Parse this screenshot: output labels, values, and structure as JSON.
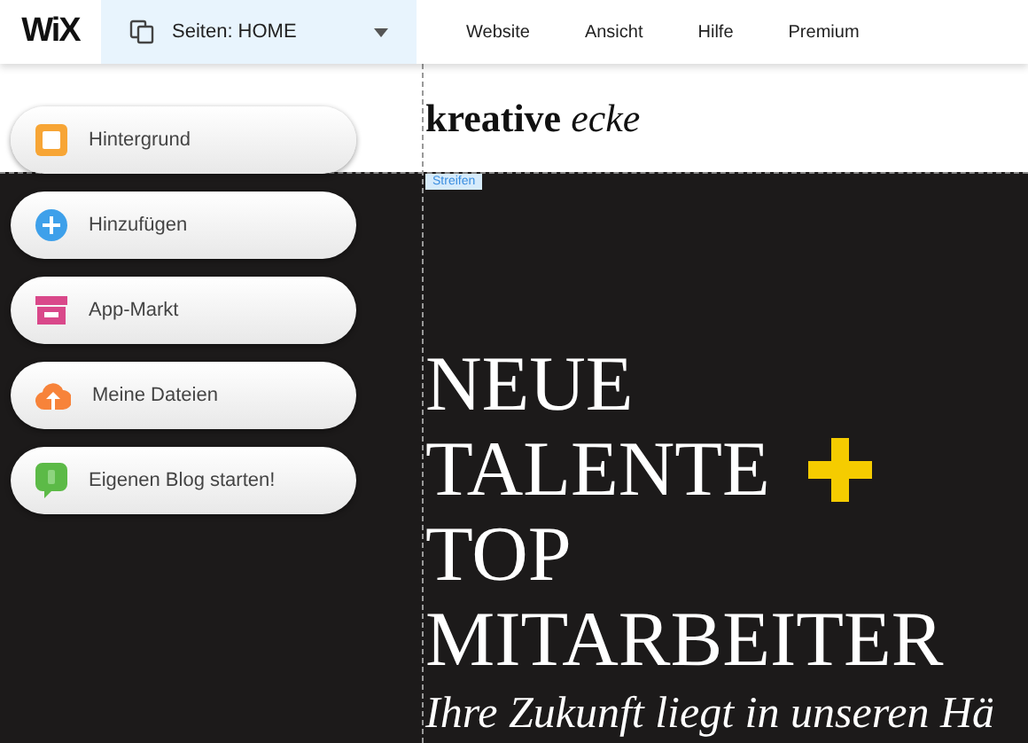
{
  "top_bar": {
    "logo": "WiX",
    "pages_menu": {
      "label": "Seiten: HOME"
    },
    "menu": [
      "Website",
      "Ansicht",
      "Hilfe",
      "Premium"
    ]
  },
  "site": {
    "title": "**kreative** *ecke*",
    "section_label": "Streifen",
    "headline": [
      {
        "text": "NEUE",
        "plus": false
      },
      {
        "text": "TALENTE",
        "plus": true
      },
      {
        "text": "TOP",
        "plus": false
      },
      {
        "text": "MITARBEITER",
        "plus": false
      }
    ],
    "subtitle": "Ihre Zukunft liegt in unseren Hä"
  },
  "sidebar": {
    "items": [
      {
        "kind": "background",
        "label": "Hintergrund"
      },
      {
        "kind": "add",
        "label": "Hinzufügen"
      },
      {
        "kind": "apps",
        "label": "App-Markt"
      },
      {
        "kind": "upload",
        "label": "Meine Dateien"
      },
      {
        "kind": "blog",
        "label": "Eigenen Blog starten!"
      }
    ]
  }
}
